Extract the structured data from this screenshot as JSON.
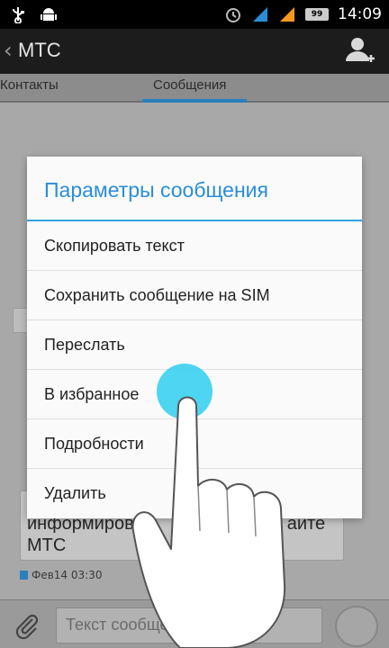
{
  "status_bar": {
    "time": "14:09",
    "battery_level": "99",
    "icons": [
      "usb-icon",
      "android-debug-icon",
      "alarm-icon",
      "signal-blue-icon",
      "signal-orange-icon",
      "battery-icon"
    ]
  },
  "action_bar": {
    "back_glyph": "‹",
    "title": "МТС",
    "add_contact_icon": "add-contact-icon"
  },
  "tabs": {
    "contacts": "Контакты",
    "messages": "Сообщения",
    "active": "messages"
  },
  "conversation": {
    "message_text": "информирован... сайте МТС",
    "message_text_line1": "информиров",
    "message_text_line1_end": "айте",
    "message_text_line2": "МТС",
    "meta": "Фев14 03:30"
  },
  "compose": {
    "placeholder": "Текст сообщения"
  },
  "dialog": {
    "title": "Параметры сообщения",
    "items": [
      "Скопировать текст",
      "Сохранить сообщение на SIM",
      "Переслать",
      "В избранное",
      "Подробности",
      "Удалить"
    ]
  },
  "colors": {
    "accent": "#2a8ed6",
    "touch_indicator": "#3ad0f0"
  }
}
